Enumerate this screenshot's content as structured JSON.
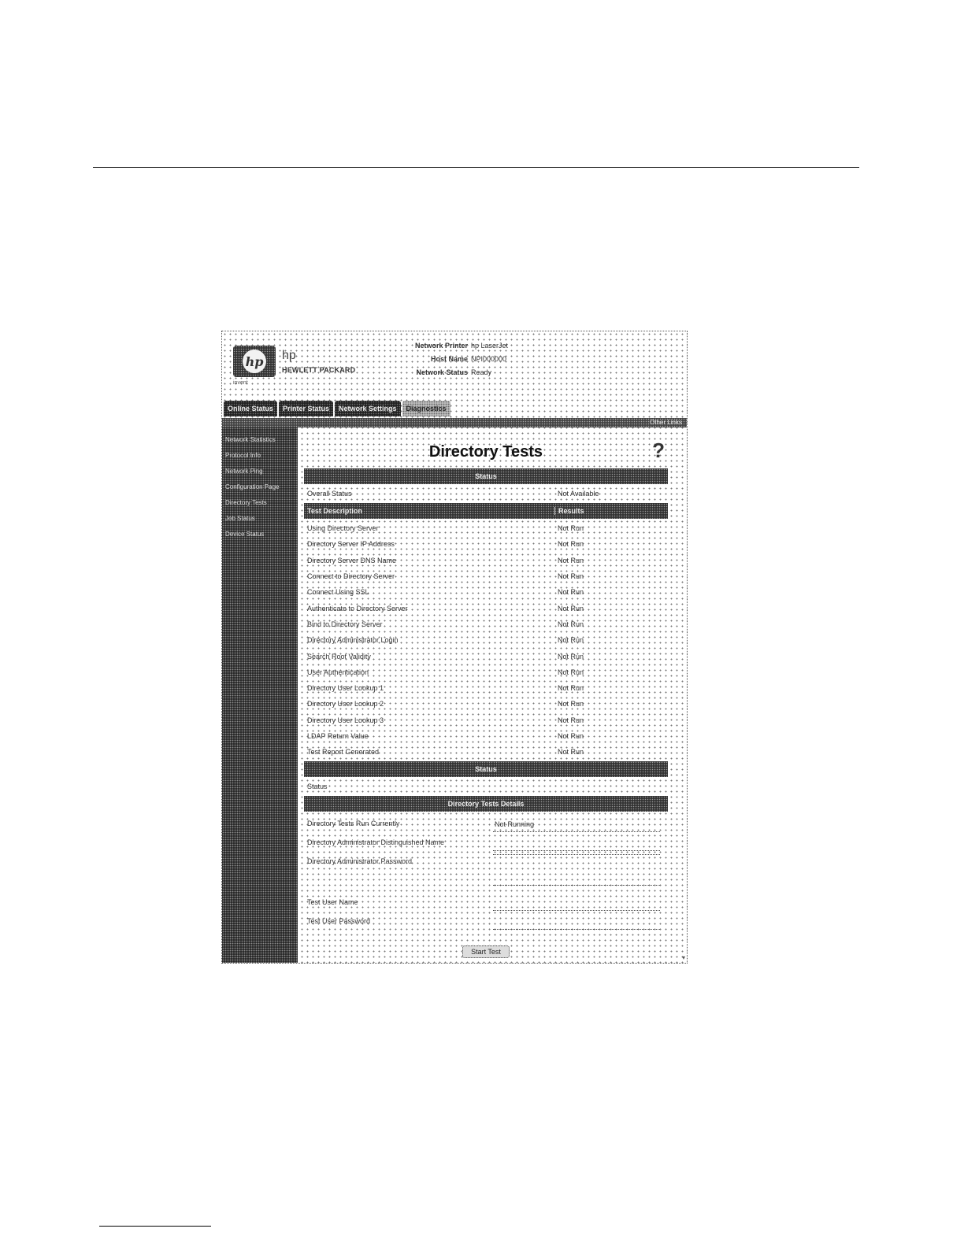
{
  "header": {
    "brand": "hp",
    "brand_sub": "HEWLETT PACKARD",
    "logo_caption": "invent",
    "info": [
      {
        "label": "Network Printer",
        "value": "hp LaserJet"
      },
      {
        "label": "Host Name",
        "value": "NPI000000"
      },
      {
        "label": "Network Status",
        "value": "Ready"
      }
    ]
  },
  "tabs": [
    {
      "label": "Online Status",
      "active": false
    },
    {
      "label": "Printer Status",
      "active": false
    },
    {
      "label": "Network Settings",
      "active": false
    },
    {
      "label": "Diagnostics",
      "active": true
    }
  ],
  "tab_bar_link": "Other Links",
  "sidebar": {
    "items": [
      "Network Statistics",
      "Protocol Info",
      "Network Ping",
      "Configuration Page",
      "Directory Tests",
      "Job Status",
      "Device Status"
    ]
  },
  "page": {
    "title": "Directory Tests",
    "help_icon": "?"
  },
  "status_section": {
    "title": "Status",
    "row": {
      "label": "Overall Status",
      "value": "Not Available"
    },
    "columns": {
      "test": "Test Description",
      "result": "Results"
    },
    "tests": [
      {
        "name": "Using Directory Server",
        "result": "Not Run"
      },
      {
        "name": "Directory Server IP Address",
        "result": "Not Run"
      },
      {
        "name": "Directory Server DNS Name",
        "result": "Not Run"
      },
      {
        "name": "Connect to Directory Server",
        "result": "Not Run"
      },
      {
        "name": "Connect Using SSL",
        "result": "Not Run"
      },
      {
        "name": "Authenticate to Directory Server",
        "result": "Not Run"
      },
      {
        "name": "Bind to Directory Server",
        "result": "Not Run"
      },
      {
        "name": "Directory Administrator Login",
        "result": "Not Run"
      },
      {
        "name": "Search Root Validity",
        "result": "Not Run"
      },
      {
        "name": "User Authentication",
        "result": "Not Run"
      },
      {
        "name": "Directory User Lookup 1",
        "result": "Not Run"
      },
      {
        "name": "Directory User Lookup 2",
        "result": "Not Run"
      },
      {
        "name": "Directory User Lookup 3",
        "result": "Not Run"
      },
      {
        "name": "LDAP Return Value",
        "result": "Not Run"
      },
      {
        "name": "Test Report Generated",
        "result": "Not Run"
      }
    ]
  },
  "status2_section": {
    "title": "Status",
    "row": {
      "label": "Status"
    }
  },
  "details_section": {
    "title": "Directory Tests Details",
    "fields": [
      {
        "label": "Directory Tests Run Currently",
        "value": "Not Running"
      },
      {
        "label": "Directory Administrator Distinguished Name",
        "value": ""
      },
      {
        "label": "Directory Administrator Password",
        "value": ""
      },
      {
        "label": "Test User Name",
        "value": ""
      },
      {
        "label": "Test User Password",
        "value": ""
      }
    ],
    "button_label": "Start Test"
  }
}
